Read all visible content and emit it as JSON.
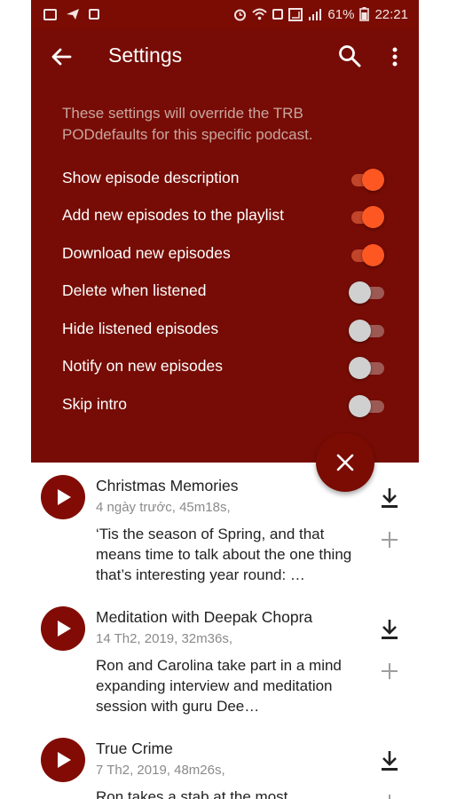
{
  "status_bar": {
    "battery_percent": "61%",
    "time": "22:21",
    "icons": [
      "gallery-icon",
      "send-icon",
      "tablet-icon",
      "alarm-icon",
      "wifi-icon",
      "sim-icon",
      "signal-icon",
      "battery-icon"
    ]
  },
  "header": {
    "title": "Settings",
    "back_icon": "arrow-left-icon",
    "search_icon": "search-icon",
    "more_icon": "more-vert-icon"
  },
  "intro_text": "These settings will override the TRB PODdefaults for this specific podcast.",
  "settings": [
    {
      "label": "Show episode description",
      "on": true
    },
    {
      "label": "Add new episodes to the playlist",
      "on": true
    },
    {
      "label": "Download new episodes",
      "on": true
    },
    {
      "label": "Delete when listened",
      "on": false
    },
    {
      "label": "Hide listened episodes",
      "on": false
    },
    {
      "label": "Notify on new episodes",
      "on": false
    },
    {
      "label": "Skip intro",
      "on": false
    }
  ],
  "close_icon": "close-icon",
  "episodes": [
    {
      "title": "Christmas Memories",
      "meta": "4 ngày trước, 45m18s,",
      "description": "‘Tis the season of Spring, and that means time to talk about the one thing that’s interesting year round: …"
    },
    {
      "title": " Meditation with Deepak Chopra",
      "meta": "14 Th2, 2019, 32m36s,",
      "description": "Ron and Carolina take part in a mind expanding interview and meditation session with guru Dee…"
    },
    {
      "title": "True Crime",
      "meta": "7 Th2, 2019, 48m26s,",
      "description": "Ron takes a stab at the most"
    }
  ],
  "colors": {
    "panel": "#760c05",
    "accent_on": "#ff5722",
    "play_button": "#820c05"
  }
}
